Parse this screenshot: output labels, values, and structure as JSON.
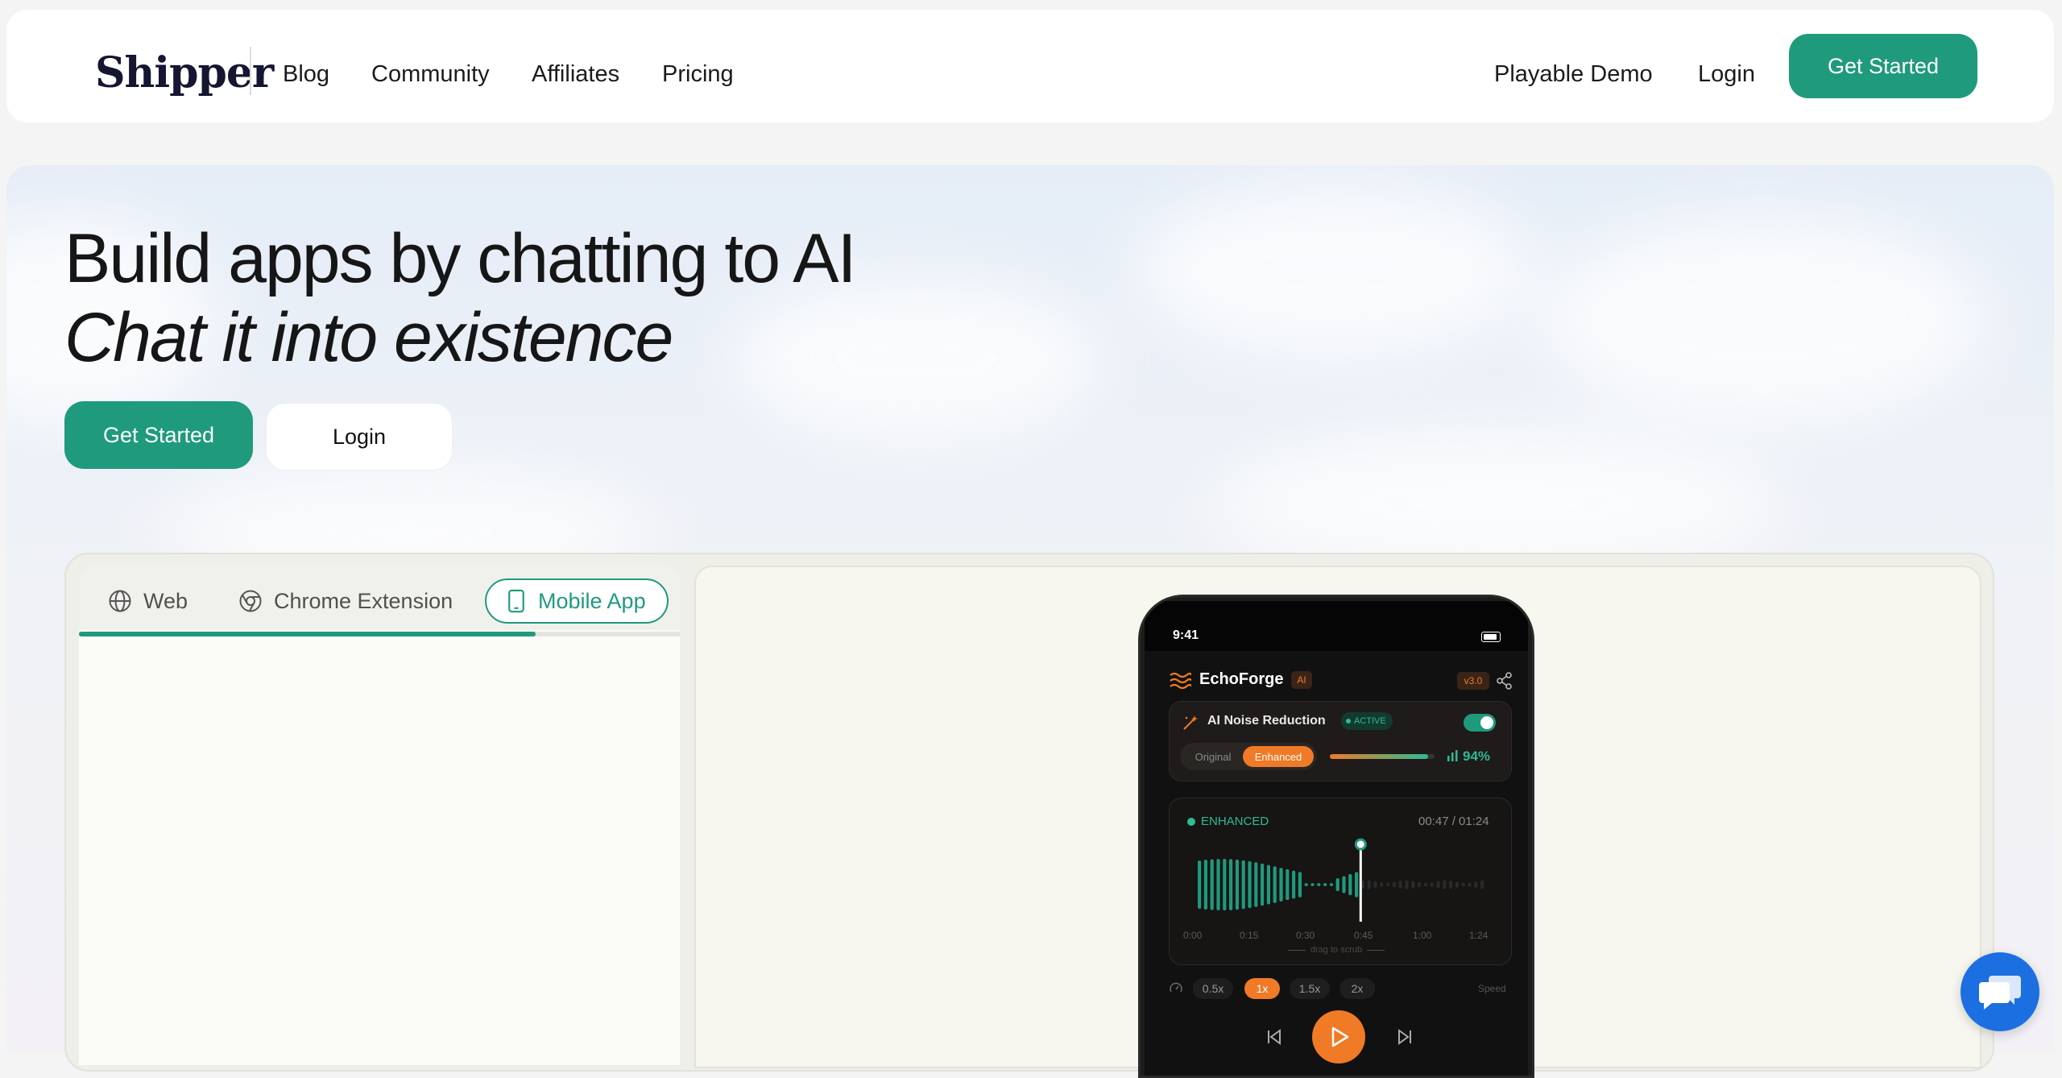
{
  "nav": {
    "logo": "Shipper",
    "links": [
      "Blog",
      "Community",
      "Affiliates",
      "Pricing"
    ],
    "right_links": [
      "Playable Demo",
      "Login"
    ],
    "cta": "Get Started"
  },
  "hero": {
    "headline": "Build apps by chatting to AI",
    "subheadline": "Chat it into existence",
    "primary_button": "Get Started",
    "secondary_button": "Login"
  },
  "demo": {
    "tabs": [
      {
        "label": "Web",
        "icon": "globe-icon",
        "active": false
      },
      {
        "label": "Chrome Extension",
        "icon": "chrome-icon",
        "active": false
      },
      {
        "label": "Mobile App",
        "icon": "phone-icon",
        "active": true
      }
    ],
    "progress_fraction": 0.76
  },
  "phone": {
    "time": "9:41",
    "app_name": "EchoForge",
    "ai_badge": "AI",
    "version": "v3.0",
    "noise": {
      "title": "AI Noise Reduction",
      "status": "ACTIVE",
      "original_label": "Original",
      "enhanced_label": "Enhanced",
      "percent": "94%",
      "level_fraction": 0.94,
      "enabled": true
    },
    "player": {
      "mode": "ENHANCED",
      "time": "00:47 / 01:24",
      "ticks": [
        "0:00",
        "0:15",
        "0:30",
        "0:45",
        "1:00",
        "1:24"
      ],
      "hint": "drag to scrub",
      "progress_fraction": 0.56
    },
    "speeds": [
      "0.5x",
      "1x",
      "1.5x",
      "2x"
    ],
    "active_speed": "1x",
    "speed_label": "Speed"
  },
  "colors": {
    "brand_green": "#1f9a7c",
    "accent_orange": "#f07a26",
    "chat_blue": "#1c6fe0"
  }
}
